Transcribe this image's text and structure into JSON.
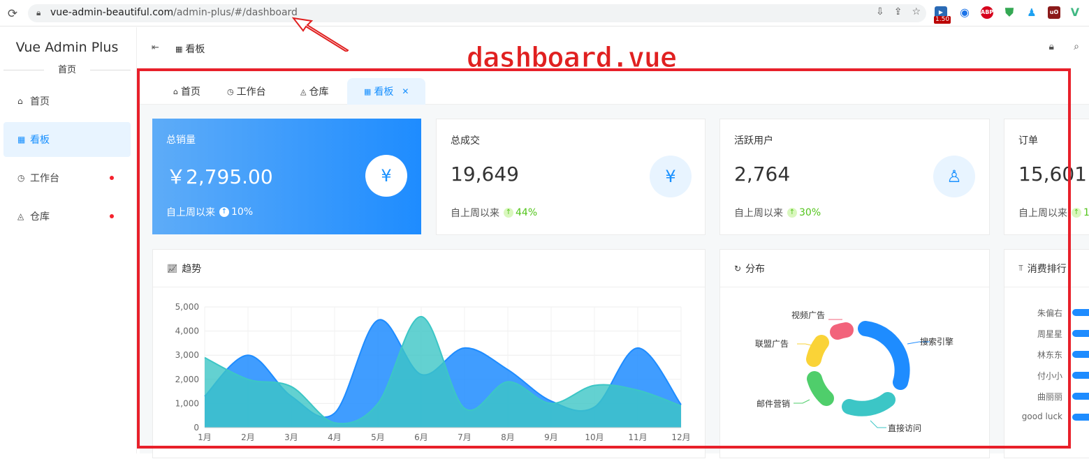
{
  "browser": {
    "url_host": "vue-admin-beautiful.com",
    "url_path": "/admin-plus/#/dashboard",
    "ext_badge_1": "1.50",
    "ext_abp": "ABP"
  },
  "sidebar": {
    "logo_title": "Vue Admin Plus",
    "logo_sub": "首页",
    "items": [
      {
        "label": "首页",
        "icon": "home-icon"
      },
      {
        "label": "看板",
        "icon": "dashboard-icon"
      },
      {
        "label": "工作台",
        "icon": "workbench-icon"
      },
      {
        "label": "仓库",
        "icon": "warehouse-icon"
      }
    ]
  },
  "header": {
    "breadcrumb": "看板"
  },
  "annotation": {
    "label": "dashboard.vue"
  },
  "tabs": [
    {
      "label": "首页"
    },
    {
      "label": "工作台"
    },
    {
      "label": "仓库"
    },
    {
      "label": "看板"
    }
  ],
  "stats": [
    {
      "title": "总销量",
      "value": "￥2,795.00",
      "foot": "自上周以来",
      "change": "10%"
    },
    {
      "title": "总成交",
      "value": "19,649",
      "foot": "自上周以来",
      "change": "44%"
    },
    {
      "title": "活跃用户",
      "value": "2,764",
      "foot": "自上周以来",
      "change": "30%"
    },
    {
      "title": "订单",
      "value": "15,601",
      "foot": "自上周以来",
      "change": "1"
    }
  ],
  "trend": {
    "title": "趋势"
  },
  "distribution": {
    "title": "分布",
    "labels": [
      "视频广告",
      "搜索引擎",
      "联盟广告",
      "邮件营销",
      "直接访问"
    ]
  },
  "ranking": {
    "title": "消费排行",
    "names": [
      "朱偏右",
      "周星星",
      "林东东",
      "付小小",
      "曲丽丽",
      "good luck"
    ]
  },
  "chart_data": {
    "type": "area",
    "categories": [
      "1月",
      "2月",
      "3月",
      "4月",
      "5月",
      "6月",
      "7月",
      "8月",
      "9月",
      "10月",
      "11月",
      "12月"
    ],
    "yticks": [
      "0",
      "1,000",
      "2,000",
      "3,000",
      "4,000",
      "5,000"
    ],
    "ylim": [
      0,
      5000
    ],
    "series": [
      {
        "values": [
          1300,
          3000,
          1300,
          600,
          4450,
          2200,
          3300,
          2400,
          1100,
          850,
          3300,
          950
        ],
        "color": "#1e8cff"
      },
      {
        "values": [
          2900,
          2000,
          1700,
          200,
          1000,
          4600,
          800,
          1900,
          1000,
          1750,
          1550,
          900
        ],
        "color": "#3cc6c6"
      }
    ]
  }
}
